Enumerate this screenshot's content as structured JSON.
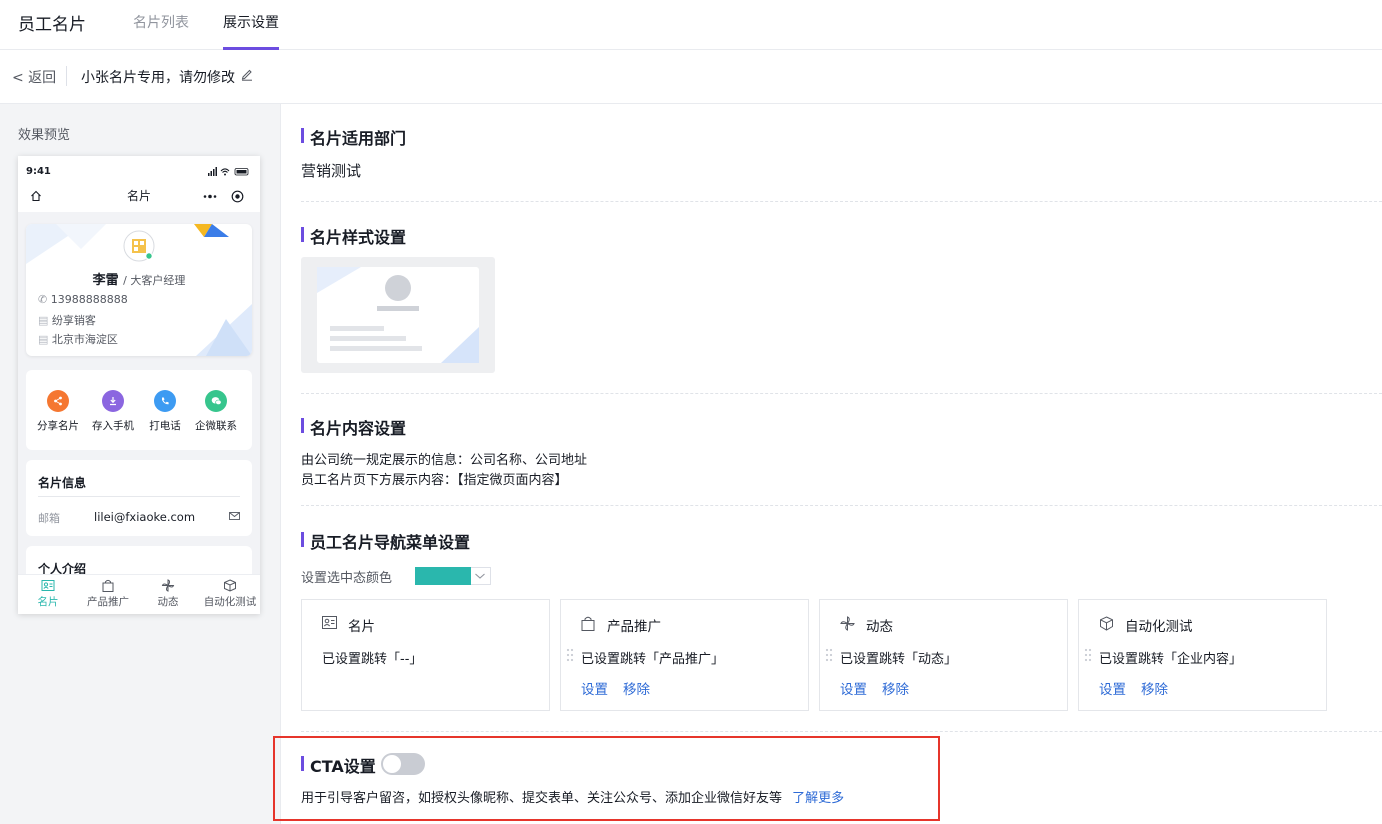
{
  "app": {
    "title": "员工名片",
    "tabs": [
      {
        "label": "名片列表"
      },
      {
        "label": "展示设置"
      }
    ]
  },
  "subheader": {
    "back_label": "< 返回",
    "card_title": "小张名片专用，请勿修改"
  },
  "preview": {
    "label": "效果预览",
    "phone": {
      "time": "9:41",
      "nav_title": "名片",
      "card": {
        "name": "李雷",
        "role": "/ 大客户经理",
        "phone": "13988888888",
        "company": "纷享销客",
        "address": "北京市海淀区"
      },
      "actions": [
        {
          "label": "分享名片",
          "color": "#f57731"
        },
        {
          "label": "存入手机",
          "color": "#8b66e0"
        },
        {
          "label": "打电话",
          "color": "#3d9bf2"
        },
        {
          "label": "企微联系",
          "color": "#37c58d"
        }
      ],
      "info_title": "名片信息",
      "email_label": "邮箱",
      "email_value": "lilei@fxiaoke.com",
      "intro_title": "个人介绍",
      "tabbar": [
        {
          "label": "名片"
        },
        {
          "label": "产品推广"
        },
        {
          "label": "动态"
        },
        {
          "label": "自动化测试"
        }
      ]
    }
  },
  "sections": {
    "dept": {
      "title": "名片适用部门",
      "value": "营销测试"
    },
    "style": {
      "title": "名片样式设置"
    },
    "content": {
      "title": "名片内容设置",
      "line1": "由公司统一规定展示的信息：公司名称、公司地址",
      "line2": "员工名片页下方展示内容：【指定微页面内容】"
    },
    "nav": {
      "title": "员工名片导航菜单设置",
      "color_label": "设置选中态颜色",
      "selected_color": "#2ab7ad",
      "items": [
        {
          "title": "名片",
          "desc": "已设置跳转「--」",
          "icon": "card-icon"
        },
        {
          "title": "产品推广",
          "desc": "已设置跳转「产品推广」",
          "set_label": "设置",
          "remove_label": "移除",
          "icon": "bag-icon"
        },
        {
          "title": "动态",
          "desc": "已设置跳转「动态」",
          "set_label": "设置",
          "remove_label": "移除",
          "icon": "pinwheel-icon"
        },
        {
          "title": "自动化测试",
          "desc": "已设置跳转「企业内容」",
          "set_label": "设置",
          "remove_label": "移除",
          "icon": "box-icon"
        }
      ]
    },
    "cta": {
      "title": "CTA设置",
      "enabled": false,
      "desc": "用于引导客户留咨，如授权头像昵称、提交表单、关注公众号、添加企业微信好友等",
      "learn_more": "了解更多"
    }
  },
  "colors": {
    "accent": "#6c4de0",
    "link": "#2d6ad6",
    "highlight_border": "#e6352b"
  }
}
